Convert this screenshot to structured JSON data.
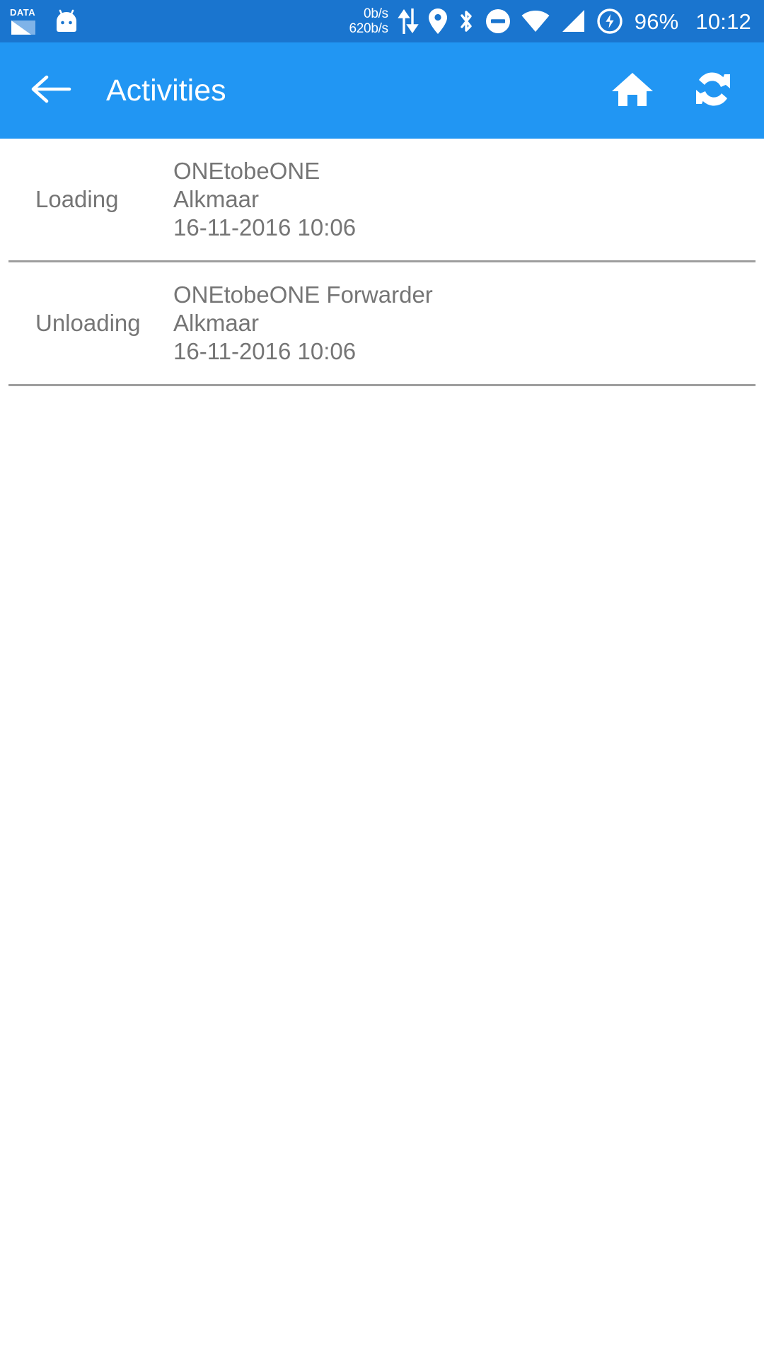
{
  "status_bar": {
    "background_color": "#1a75cf",
    "icons_left": [
      {
        "name": "data-sim-icon",
        "label": "DATA"
      },
      {
        "name": "android-head-icon",
        "label": "Android"
      }
    ],
    "network_speed": {
      "upload": "0b/s",
      "download": "620b/s"
    },
    "icons_right": [
      {
        "name": "data-transfer-arrows-icon"
      },
      {
        "name": "location-pin-icon"
      },
      {
        "name": "bluetooth-icon"
      },
      {
        "name": "do-not-disturb-icon"
      },
      {
        "name": "wifi-icon"
      },
      {
        "name": "cell-signal-icon"
      },
      {
        "name": "battery-charging-icon"
      }
    ],
    "battery_percent": "96%",
    "clock": "10:12"
  },
  "app_bar": {
    "background_color": "#2196f3",
    "back_icon": "arrow-back-icon",
    "title": "Activities",
    "actions": [
      {
        "name": "home-button",
        "icon": "home-icon"
      },
      {
        "name": "refresh-button",
        "icon": "refresh-icon"
      }
    ]
  },
  "activities": {
    "text_color": "#757575",
    "rows": [
      {
        "label": "Loading",
        "company": "ONEtobeONE",
        "city": "Alkmaar",
        "datetime": "16-11-2016 10:06"
      },
      {
        "label": "Unloading",
        "company": "ONEtobeONE Forwarder",
        "city": "Alkmaar",
        "datetime": "16-11-2016 10:06"
      }
    ]
  }
}
